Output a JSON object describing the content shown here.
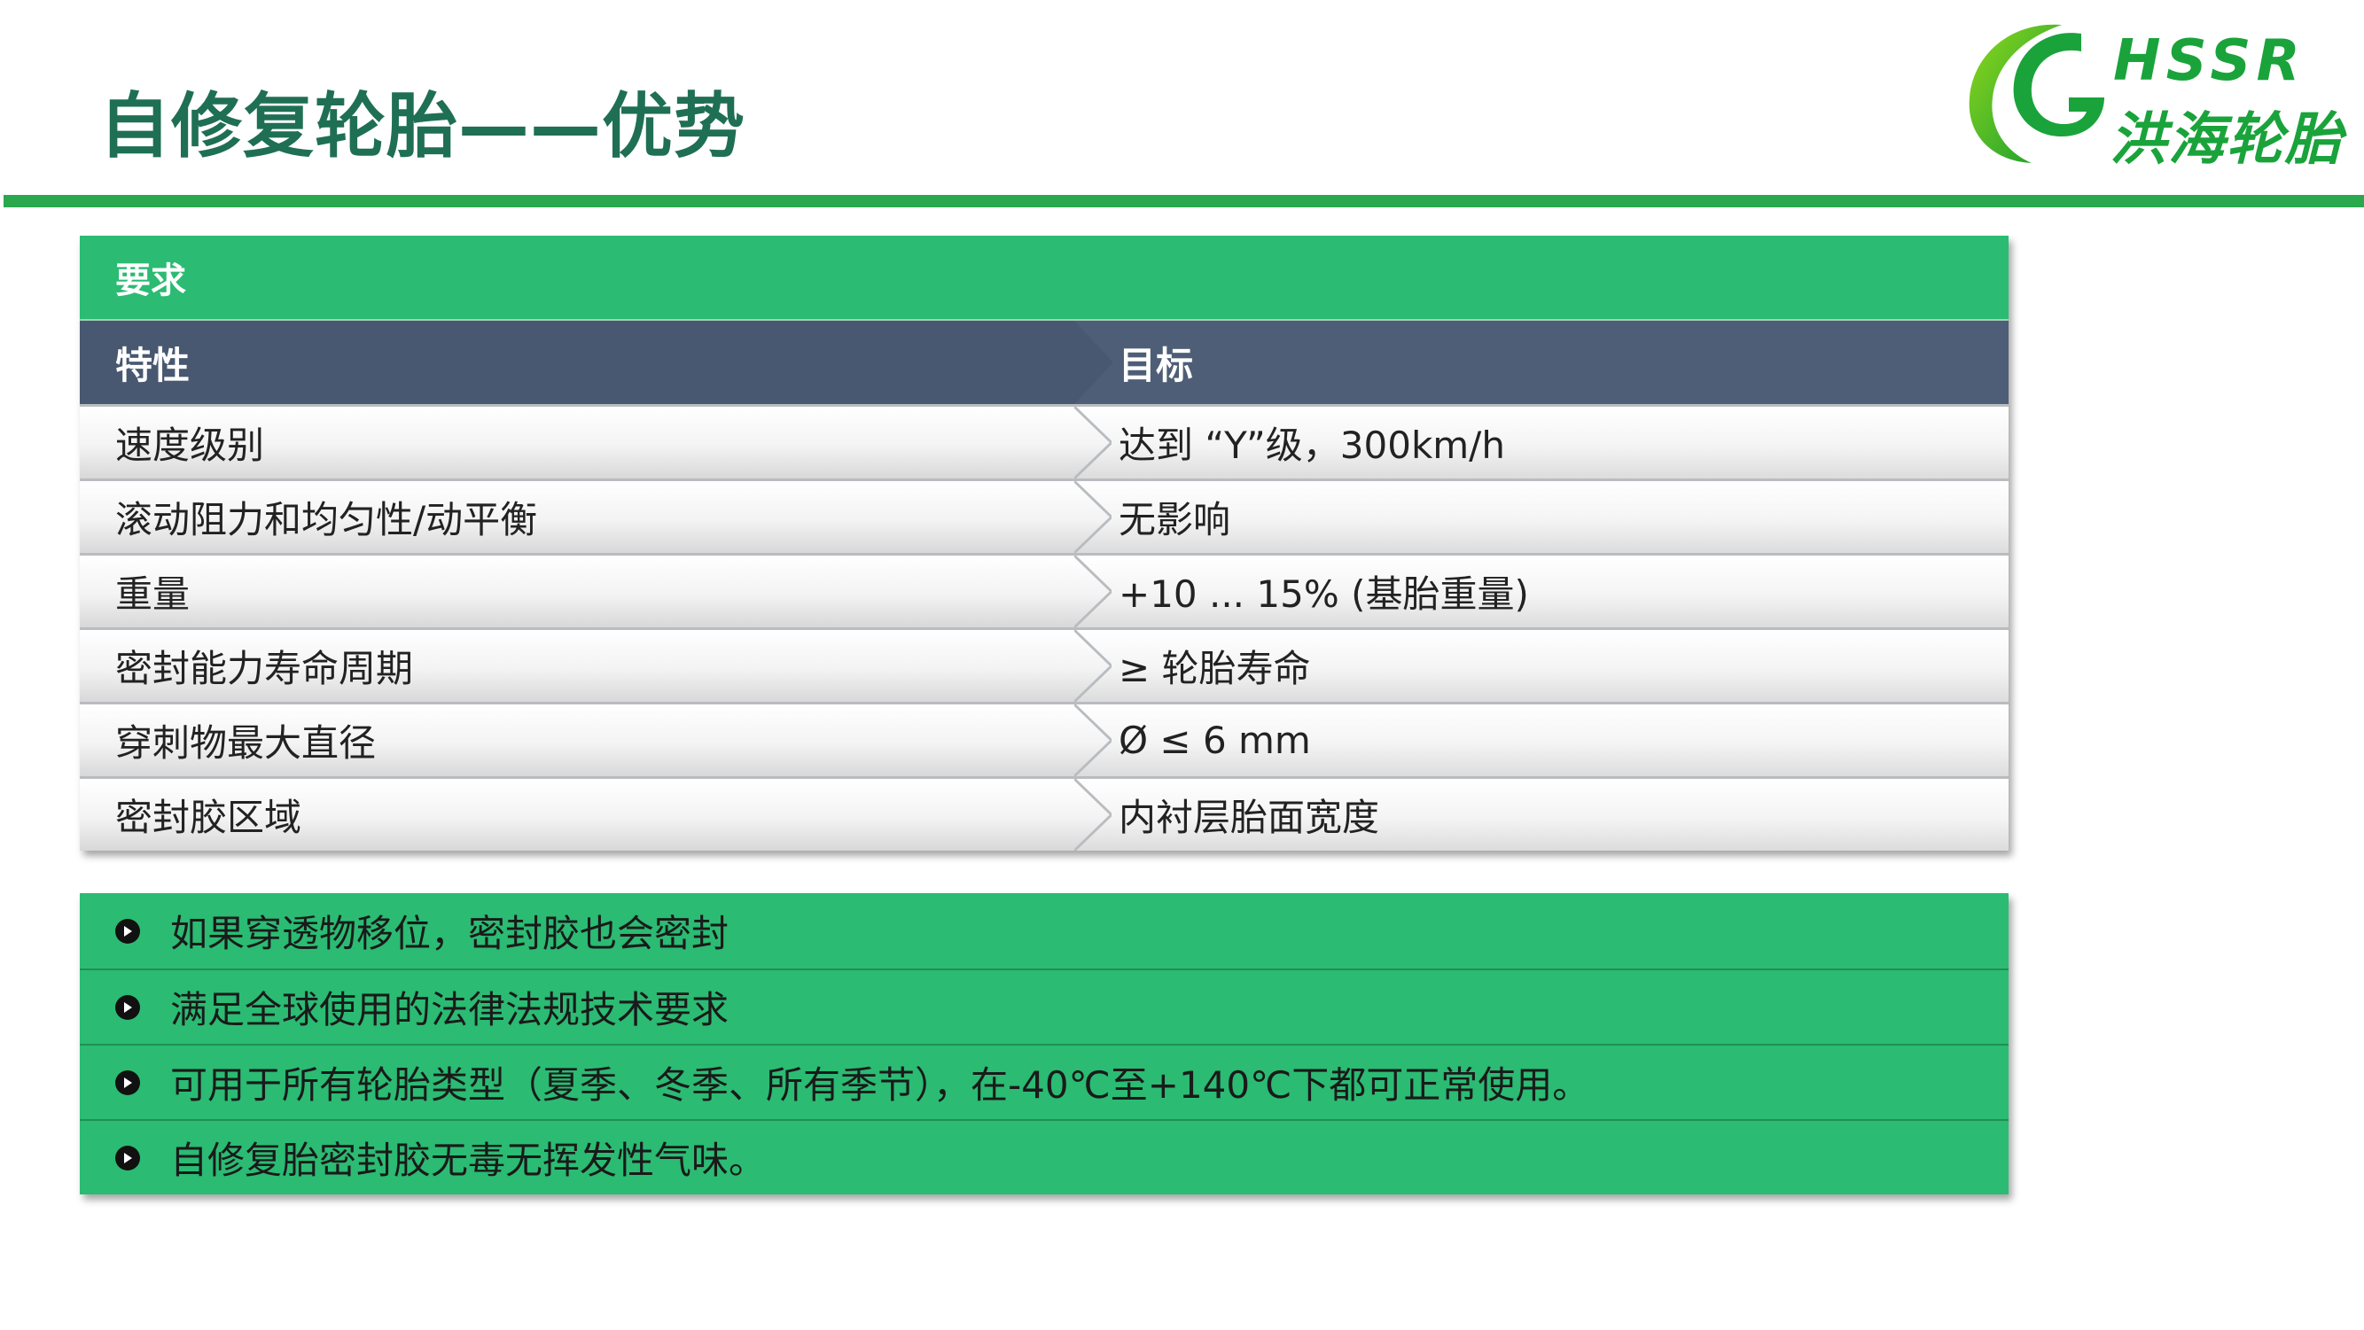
{
  "slide": {
    "title": "自修复轮胎——优势"
  },
  "logo": {
    "latin": "HSSR",
    "chinese": "洪海轮胎"
  },
  "requirements_table": {
    "header": "要求",
    "columns": {
      "property": "特性",
      "target": "目标"
    },
    "rows": [
      {
        "property": "速度级别",
        "target": "达到 “Y”级，300km/h"
      },
      {
        "property": "滚动阻力和均匀性/动平衡",
        "target": "无影响"
      },
      {
        "property": "重量",
        "target": "+10 ... 15% (基胎重量)"
      },
      {
        "property": "密封能力寿命周期",
        "target": "≥ 轮胎寿命"
      },
      {
        "property": "穿刺物最大直径",
        "target": "Ø ≤ 6 mm"
      },
      {
        "property": "密封胶区域",
        "target": "内衬层胎面宽度"
      }
    ]
  },
  "benefits": [
    "如果穿透物移位，密封胶也会密封",
    "满足全球使用的法律法规技术要求",
    "可用于所有轮胎类型（夏季、冬季、所有季节），在-40℃至+140℃下都可正常使用。",
    "自修复胎密封胶无毒无挥发性气味。"
  ],
  "colors": {
    "title": "#1f6f55",
    "accent_green": "#2bbb73",
    "rule_green": "#2aa84e",
    "header_slate": "#4e5e76",
    "logo_green": "#1aa33b"
  },
  "icons": {
    "bullet": "circle-play-bullet-icon",
    "row_separator": "chevron-right-icon",
    "logo_mark": "hssr-logo-icon"
  }
}
